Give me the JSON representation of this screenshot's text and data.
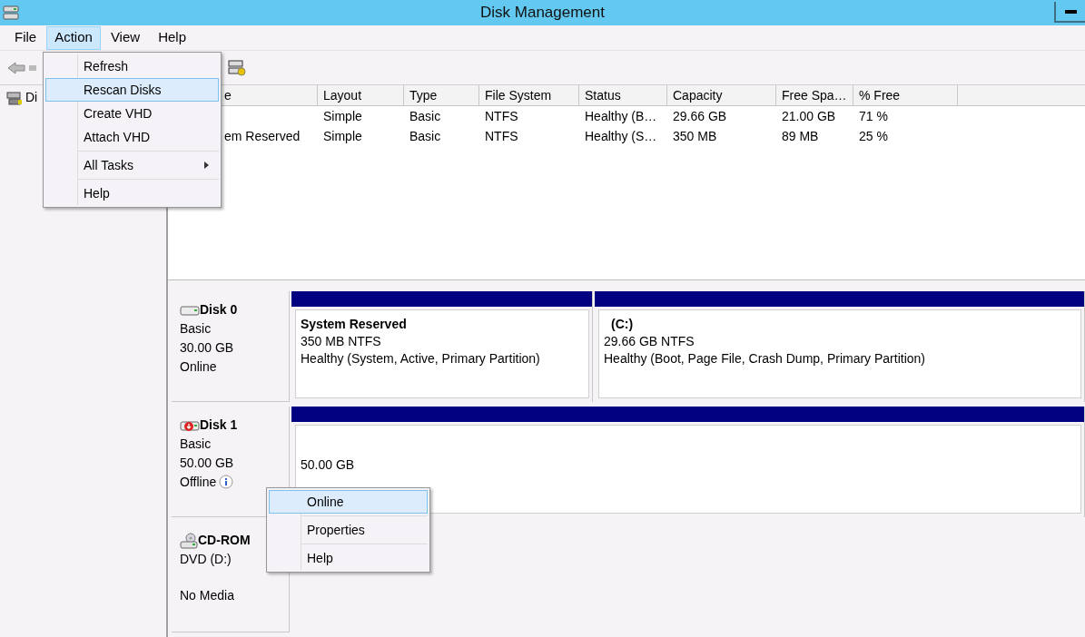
{
  "window": {
    "title": "Disk Management"
  },
  "menu_bar": [
    {
      "label": "File",
      "selected": false
    },
    {
      "label": "Action",
      "selected": true
    },
    {
      "label": "View",
      "selected": false
    },
    {
      "label": "Help",
      "selected": false
    }
  ],
  "navigation_tree": {
    "items": [
      {
        "label": "Di"
      }
    ]
  },
  "volume_table": {
    "columns": [
      "e",
      "Layout",
      "Type",
      "File System",
      "Status",
      "Capacity",
      "Free Spa…",
      "% Free"
    ],
    "rows": [
      {
        "layout": "Simple",
        "type": "Basic",
        "file_system": "NTFS",
        "status": "Healthy (B…",
        "capacity": "29.66 GB",
        "free_space": "21.00 GB",
        "percent_free": "71 %"
      },
      {
        "name": "em Reserved",
        "layout": "Simple",
        "type": "Basic",
        "file_system": "NTFS",
        "status": "Healthy (S…",
        "capacity": "350 MB",
        "free_space": "89 MB",
        "percent_free": "25 %"
      }
    ]
  },
  "disks": [
    {
      "kind": "hdd",
      "name": "Disk 0",
      "offline": false,
      "lines": [
        "Basic",
        "30.00 GB",
        "Online"
      ],
      "partitions": [
        {
          "title": "System Reserved",
          "lines": [
            "350 MB NTFS",
            "Healthy (System, Active, Primary Partition)"
          ]
        },
        {
          "title": "(C:)",
          "lines": [
            "29.66 GB NTFS",
            "Healthy (Boot, Page File, Crash Dump, Primary Partition)"
          ]
        }
      ]
    },
    {
      "kind": "hdd",
      "name": "Disk 1",
      "offline": true,
      "lines": [
        "Basic",
        "50.00 GB",
        "Offline"
      ],
      "partitions": [
        {
          "lines": [
            "50.00 GB"
          ]
        }
      ]
    },
    {
      "kind": "cdrom",
      "name": "CD-ROM",
      "lines": [
        "DVD (D:)",
        "No Media"
      ]
    }
  ],
  "action_menu": {
    "groups": [
      [
        {
          "label": "Refresh",
          "selected": false,
          "submenu": false
        },
        {
          "label": "Rescan Disks",
          "selected": true,
          "submenu": false
        },
        {
          "label": "Create VHD",
          "selected": false,
          "submenu": false
        },
        {
          "label": "Attach VHD",
          "selected": false,
          "submenu": false
        }
      ],
      [
        {
          "label": "All Tasks",
          "selected": false,
          "submenu": true
        }
      ],
      [
        {
          "label": "Help",
          "selected": false,
          "submenu": false
        }
      ]
    ]
  },
  "context_menu": {
    "groups": [
      [
        {
          "label": "Online",
          "selected": true
        }
      ],
      [
        {
          "label": "Properties",
          "selected": false
        }
      ],
      [
        {
          "label": "Help",
          "selected": false
        }
      ]
    ]
  }
}
